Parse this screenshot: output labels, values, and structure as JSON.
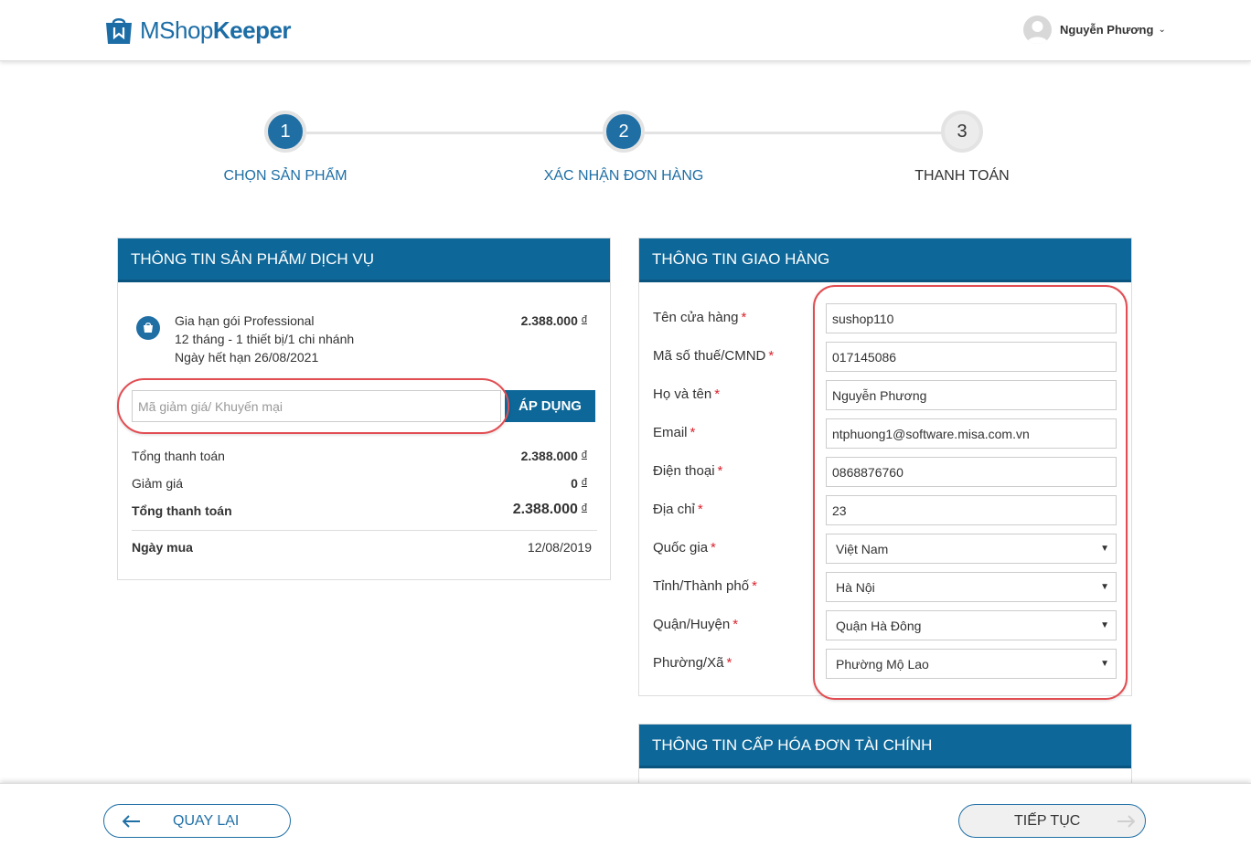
{
  "header": {
    "logo_prefix": "MShop",
    "logo_suffix": "Keeper",
    "user_name": "Nguyễn Phương"
  },
  "steps": [
    {
      "number": "1",
      "label": "CHỌN SẢN PHẨM",
      "state": "done"
    },
    {
      "number": "2",
      "label": "XÁC NHẬN ĐƠN HÀNG",
      "state": "done"
    },
    {
      "number": "3",
      "label": "THANH TOÁN",
      "state": "todo"
    }
  ],
  "product_panel": {
    "title": "THÔNG TIN SẢN PHẨM/ DỊCH VỤ",
    "product": {
      "name": "Gia hạn gói Professional",
      "detail": "12 tháng - 1 thiết bị/1 chi nhánh",
      "expiry": "Ngày hết hạn 26/08/2021",
      "price": "2.388.000",
      "currency": "đ"
    },
    "promo_placeholder": "Mã giảm giá/ Khuyến mại",
    "apply_label": "ÁP DỤNG",
    "subtotal_label": "Tổng thanh toán",
    "subtotal_value": "2.388.000",
    "discount_label": "Giảm giá",
    "discount_value": "0",
    "total_label": "Tổng thanh toán",
    "total_value": "2.388.000",
    "date_label": "Ngày mua",
    "date_value": "12/08/2019"
  },
  "delivery_panel": {
    "title": "THÔNG TIN GIAO HÀNG",
    "fields": [
      {
        "label": "Tên cửa hàng",
        "value": "sushop110",
        "type": "input"
      },
      {
        "label": "Mã số thuế/CMND",
        "value": "017145086",
        "type": "input"
      },
      {
        "label": "Họ và tên",
        "value": "Nguyễn Phương",
        "type": "input"
      },
      {
        "label": "Email",
        "value": "ntphuong1@software.misa.com.vn",
        "type": "input"
      },
      {
        "label": "Điện thoại",
        "value": "0868876760",
        "type": "input"
      },
      {
        "label": "Địa chỉ",
        "value": "23",
        "type": "input"
      },
      {
        "label": "Quốc gia",
        "value": "Việt Nam",
        "type": "select"
      },
      {
        "label": "Tỉnh/Thành phố",
        "value": "Hà Nội",
        "type": "select"
      },
      {
        "label": "Quận/Huyện",
        "value": "Quận Hà Đông",
        "type": "select"
      },
      {
        "label": "Phường/Xã",
        "value": "Phường Mộ Lao",
        "type": "select"
      }
    ],
    "required_mark": "*"
  },
  "invoice_panel": {
    "title": "THÔNG TIN CẤP HÓA ĐƠN TÀI CHÍNH"
  },
  "footer": {
    "back_label": "QUAY LẠI",
    "next_label": "TIẾP TỤC"
  },
  "colors": {
    "primary": "#0d6798",
    "accent": "#1f6fa5",
    "highlight": "#e14d52",
    "required": "#d9232d"
  }
}
